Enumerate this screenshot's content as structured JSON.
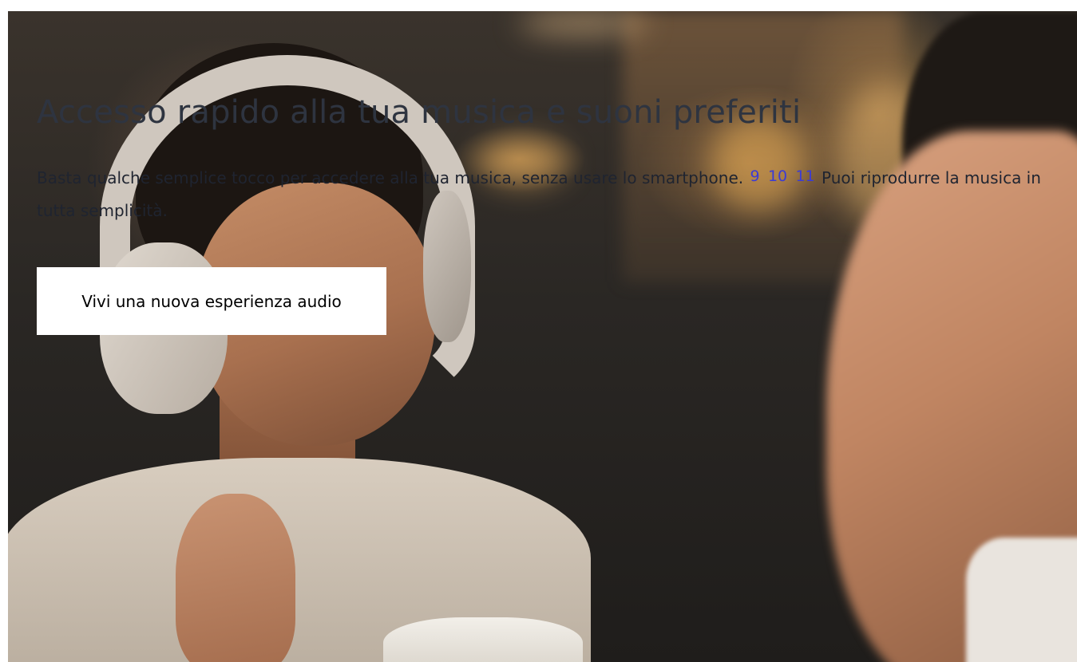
{
  "hero": {
    "image_alt": "Donna che indossa cuffie e sorride in un caffè",
    "headline": "Accesso rapido alla tua musica e suoni preferiti",
    "body_before_links": "Basta qualche semplice tocco per accedere alla tua musica, senza usare lo smartphone.",
    "footnotes": [
      "9",
      "10",
      "11"
    ],
    "body_after_links": "Puoi riprodurre la musica in tutta semplicità.",
    "cta_label": "Vivi una nuova esperienza audio"
  },
  "colors": {
    "headline": "#2e3440",
    "body": "#1f2430",
    "link": "#3b3bd6",
    "cta_background": "#ffffff"
  }
}
